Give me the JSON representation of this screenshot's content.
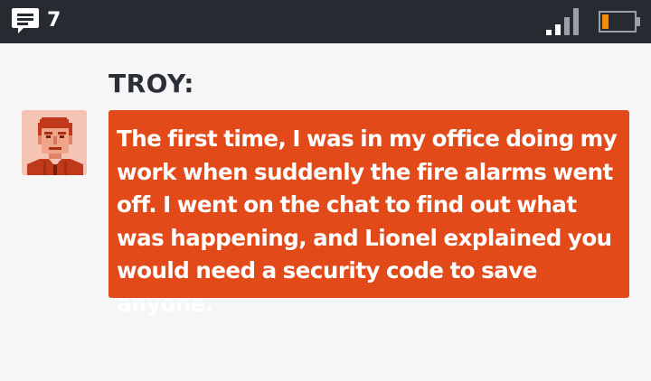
{
  "status_bar": {
    "chat_icon": "chat-bubble-icon",
    "notification_count": "7",
    "signal_icon": "signal-bars-icon",
    "battery_icon": "battery-low-icon",
    "battery_level": 0.2
  },
  "message": {
    "speaker": "TROY:",
    "avatar_icon": "troy-pixel-portrait",
    "text": "The first time, I was in my office doing my work when suddenly the fire alarms went off. I went on the chat to find out what was happening, and Lionel explained you would need a security code to save anyone."
  },
  "colors": {
    "status_bar_bg": "#262b31",
    "background": "#f6f6f6",
    "bubble": "#e24a1a",
    "speaker_text": "#2b3038",
    "battery_fill": "#f28c12"
  }
}
